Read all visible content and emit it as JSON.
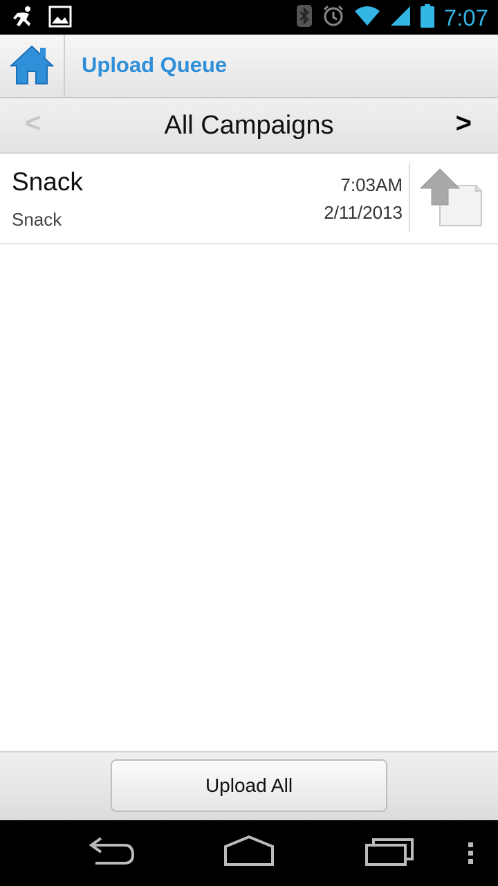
{
  "status_bar": {
    "time": "7:07",
    "icons": [
      "running-notification-icon",
      "image-notification-icon",
      "bluetooth-icon",
      "alarm-icon",
      "wifi-icon",
      "signal-icon",
      "battery-icon"
    ]
  },
  "action_bar": {
    "title": "Upload Queue",
    "home_icon": "home-icon"
  },
  "campaign_nav": {
    "prev_label": "<",
    "next_label": ">",
    "title": "All Campaigns"
  },
  "queue": {
    "items": [
      {
        "title": "Snack",
        "subtitle": "Snack",
        "time": "7:03AM",
        "date": "2/11/2013",
        "icon": "upload-file-icon"
      }
    ]
  },
  "bottom": {
    "upload_all_label": "Upload All"
  },
  "nav_bar": {
    "icons": [
      "back-icon",
      "home-nav-icon",
      "recent-apps-icon",
      "overflow-menu-icon"
    ]
  },
  "colors": {
    "accent": "#33b5e5",
    "title_blue": "#2f8fd8",
    "status_bg": "#000000"
  }
}
